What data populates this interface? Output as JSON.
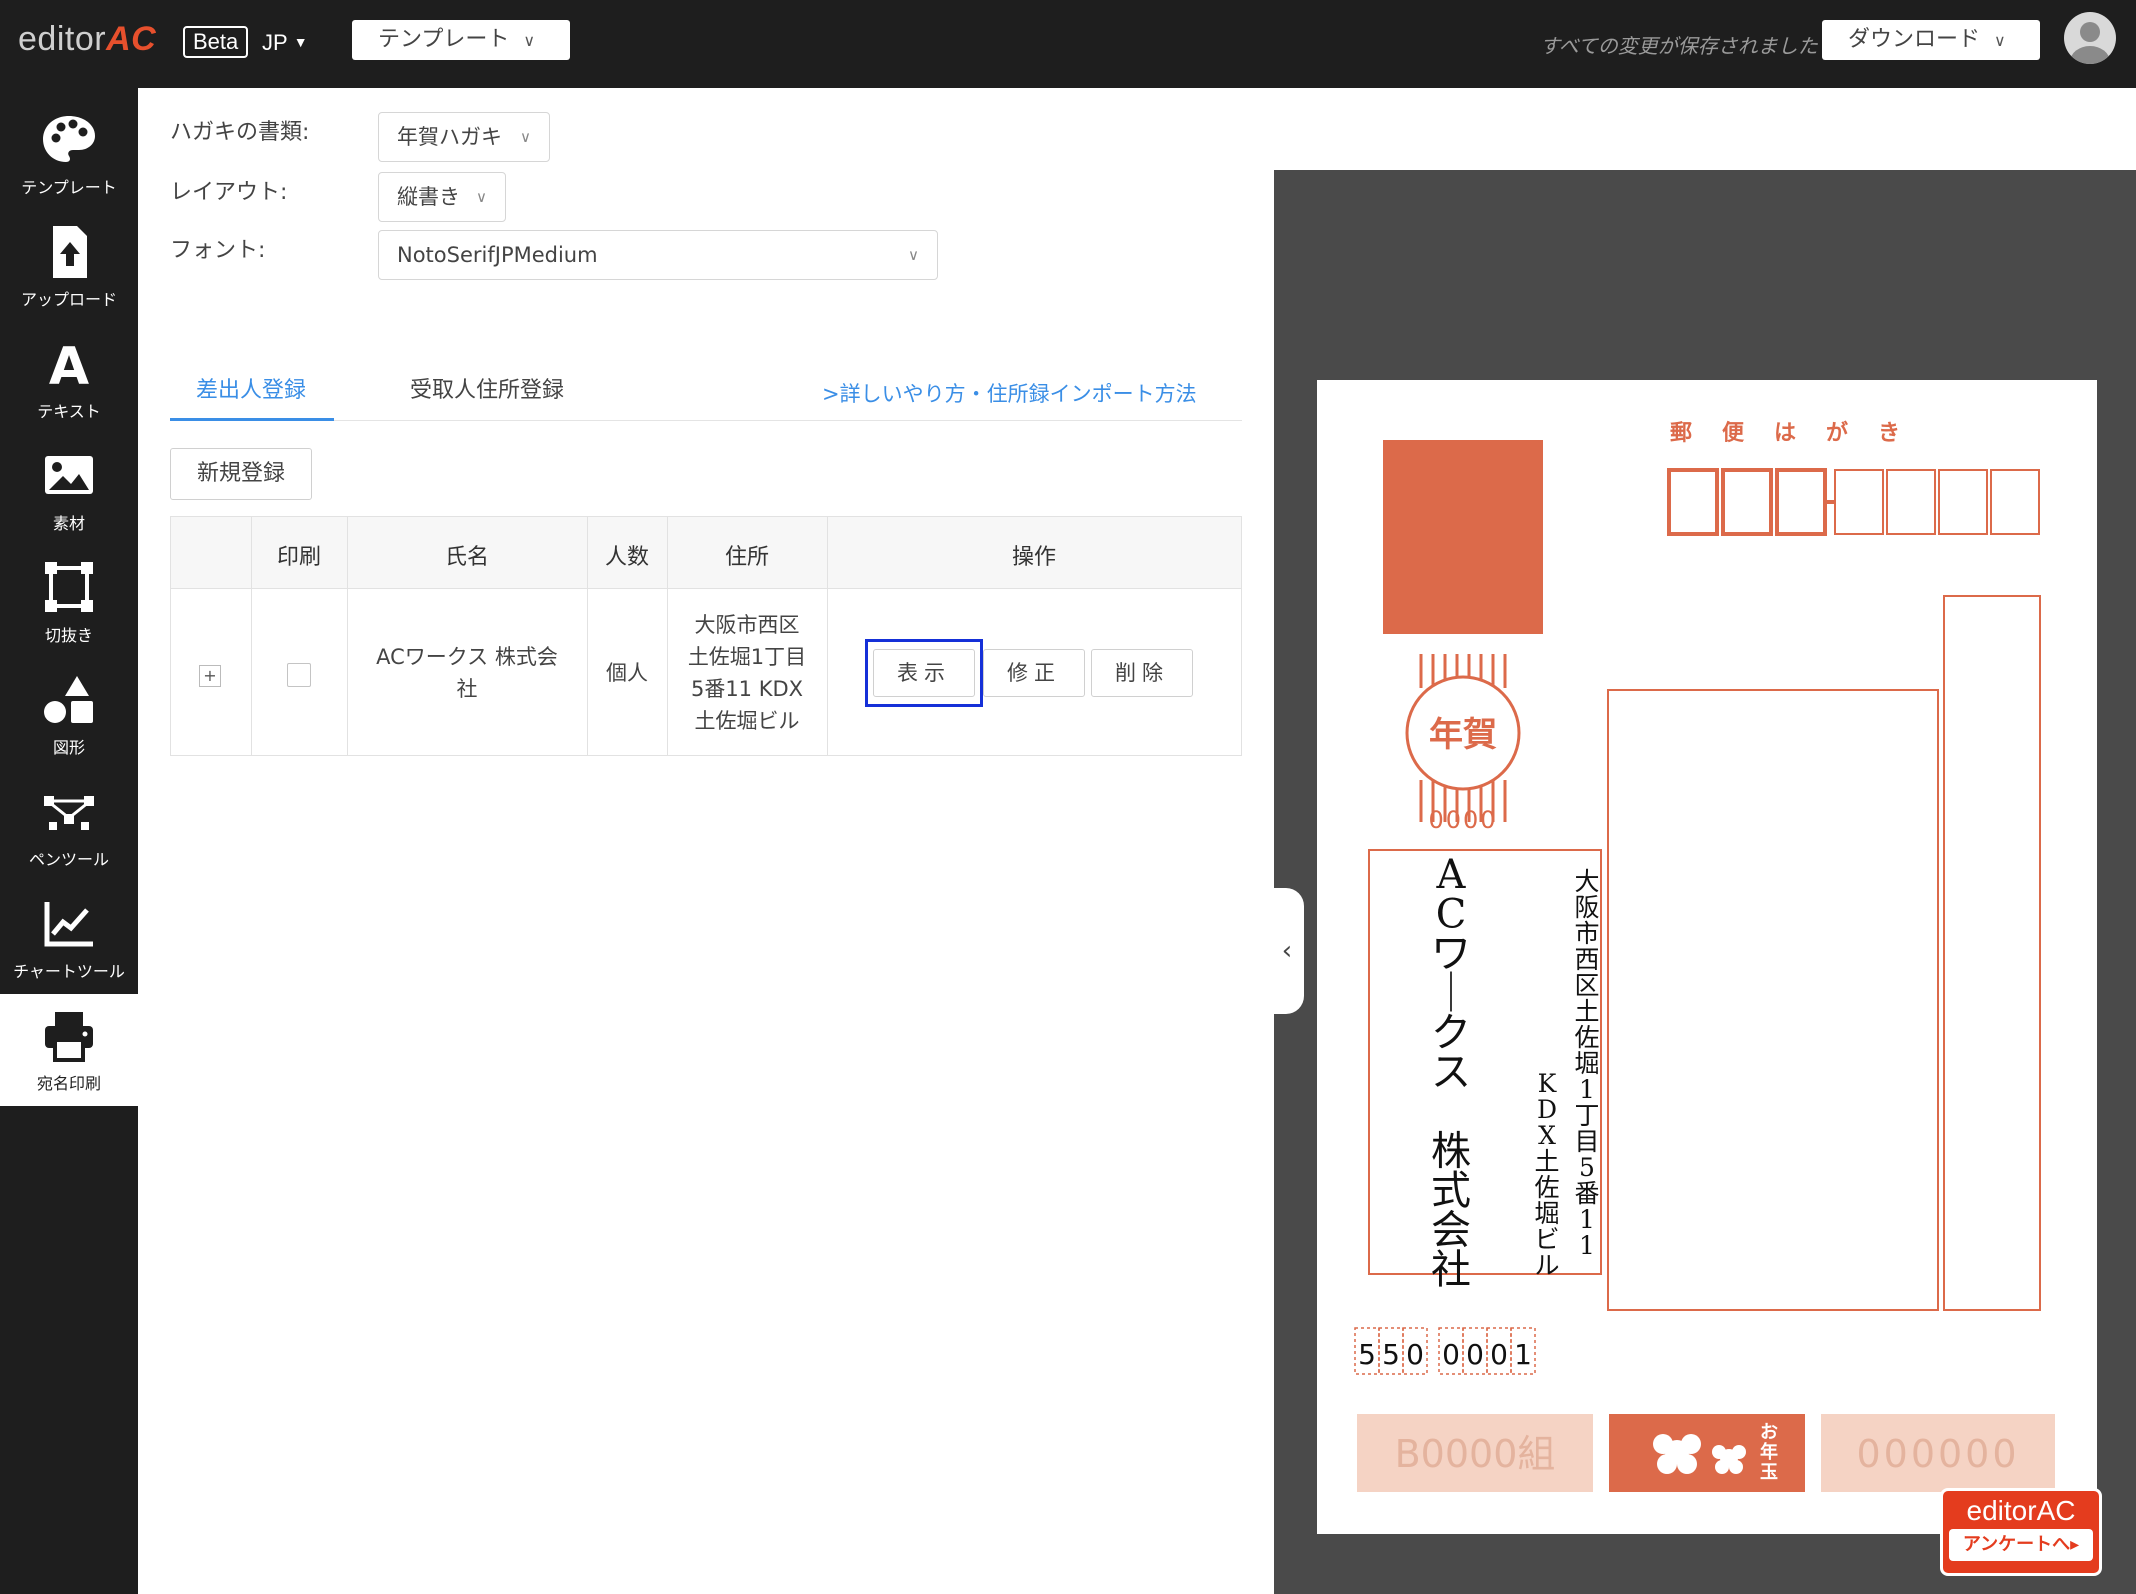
{
  "topbar": {
    "logo_text": "editor",
    "logo_accent": "AC",
    "beta_label": "Beta",
    "lang_label": "JP",
    "template_dropdown": "テンプレート",
    "saved_status": "すべての変更が保存されました",
    "download_dropdown": "ダウンロード"
  },
  "sidebar": {
    "items": [
      {
        "label": "テンプレート",
        "icon": "palette-icon"
      },
      {
        "label": "アップロード",
        "icon": "upload-icon"
      },
      {
        "label": "テキスト",
        "icon": "text-icon"
      },
      {
        "label": "素材",
        "icon": "image-icon"
      },
      {
        "label": "切抜き",
        "icon": "crop-icon"
      },
      {
        "label": "図形",
        "icon": "shapes-icon"
      },
      {
        "label": "ペンツール",
        "icon": "pen-tool-icon"
      },
      {
        "label": "チャートツール",
        "icon": "chart-icon"
      },
      {
        "label": "宛名印刷",
        "icon": "printer-icon"
      }
    ],
    "active": "宛名印刷"
  },
  "form": {
    "card_type_label": "ハガキの書類:",
    "card_type_value": "年賀ハガキ",
    "layout_label": "レイアウト:",
    "layout_value": "縦書き",
    "font_label": "フォント:",
    "font_value": "NotoSerifJPMedium"
  },
  "tabs": {
    "sender": "差出人登録",
    "receiver": "受取人住所登録",
    "help_link": ">詳しいやり方・住所録インポート方法"
  },
  "new_button": "新規登録",
  "table": {
    "headers": [
      "",
      "印刷",
      "氏名",
      "人数",
      "住所",
      "操作"
    ],
    "rows": [
      {
        "expand": "+",
        "name_line1": "ACワークス 株式会",
        "name_line2": "社",
        "count": "個人",
        "address_lines": [
          "大阪市西区",
          "土佐堀1丁目",
          "5番11 KDX",
          "土佐堀ビル"
        ],
        "actions": {
          "show": "表示",
          "edit": "修正",
          "delete": "削除"
        }
      }
    ]
  },
  "postcard": {
    "header": [
      "郵",
      "便",
      "は",
      "が",
      "き"
    ],
    "stamp_label": "年賀",
    "stamp_digits": "0000",
    "sender_name_vertical": [
      "A",
      "C",
      "ワ",
      "ー",
      "ク",
      "ス",
      "　",
      "株",
      "式",
      "会",
      "社"
    ],
    "sender_address_vertical1": [
      "大",
      "阪",
      "市",
      "西",
      "区",
      "土",
      "佐",
      "堀",
      "1",
      "丁",
      "目",
      "5",
      "番",
      "1",
      "1"
    ],
    "sender_address_vertical2": [
      "K",
      "D",
      "X",
      "土",
      "佐",
      "堀",
      "ビ",
      "ル"
    ],
    "sender_zip": [
      "5",
      "5",
      "0",
      "0",
      "0",
      "0",
      "1"
    ],
    "lottery_left": "B0000組",
    "lottery_mid": "お年玉",
    "lottery_right": "000000",
    "accent_color": "#dc6a4a",
    "light_color": "#f5d3c4"
  },
  "survey_badge": {
    "logo": "editorAC",
    "label": "アンケートへ▸"
  }
}
